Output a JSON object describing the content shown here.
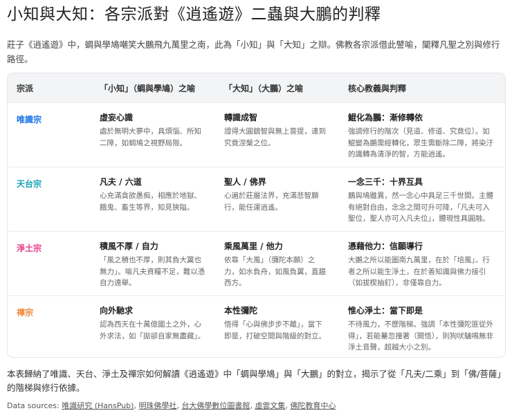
{
  "title": "小知與大知：各宗派對《逍遙遊》二蟲與大鵬的判釋",
  "intro": "莊子《逍遙遊》中，蜩與學鳩嘲笑大鵬飛九萬里之南，此為「小知」與「大知」之辯。佛教各宗派借此譬喻，闡釋凡聖之別與修行路徑。",
  "table": {
    "headers": [
      "宗派",
      "「小知」（蜩與學鳩）之喻",
      "「大知」（大鵬）之喻",
      "核心教義與判釋"
    ],
    "rows": [
      {
        "school": "唯識宗",
        "color": "#1a73e8",
        "small_title": "虛妄心識",
        "small_desc": "處於無明大夢中，具煩惱、所知二障，如蜩鳩之視野局限。",
        "big_title": "轉識成智",
        "big_desc": "證得大圓鏡智與無上菩提，達到究竟涅槃之位。",
        "core_title": "鯤化為鵬：漸修轉依",
        "core_desc": "強調修行的階次（見道、修道、究竟位）。如鯤變為鵬需經轉化，眾生需斷除二障，將染汙的識轉為清淨的智，方能逍遙。"
      },
      {
        "school": "天台宗",
        "color": "#17a2b8",
        "small_title": "凡夫 / 六道",
        "small_desc": "心充滿貪欲愚痴，相應於地獄、餓鬼、畜生等界，知見狹隘。",
        "big_title": "聖人 / 佛界",
        "big_desc": "心遍於莊嚴法界，充滿悲智願行，能任運逍遙。",
        "core_title": "一念三千：十界互具",
        "core_desc": "鵬與鳩雖異，然一念心中具足三千世間。主體有絕對自由，念念之間可升可降，「凡夫可入聖位，聖人亦可入凡夫位」，體現性具圓融。"
      },
      {
        "school": "淨土宗",
        "color": "#e83e8c",
        "small_title": "積風不厚 / 自力",
        "small_desc": "「風之積也不厚，則其負大翼也無力」。喻凡夫資糧不足，難以憑自力遠舉。",
        "big_title": "乘風萬里 / 他力",
        "big_desc": "依靠「大風」（彌陀本願）之力，如水負舟，如風負翼，直趨西方。",
        "core_title": "憑藉他力：信願導行",
        "core_desc": "大鵬之所以能圖南九萬里，在於「培風」。行者之所以能生淨土，在於善知識與佛力接引（如拔楔抽釘），非僅靠自力。"
      },
      {
        "school": "禪宗",
        "color": "#f0883e",
        "small_title": "向外馳求",
        "small_desc": "認為西天在十萬億國土之外，心外求法，如「拋卻自家無盡藏」。",
        "big_title": "本性彌陀",
        "big_desc": "悟得「心與佛步步不離」，當下即是，打破空間與階級的對立。",
        "core_title": "惟心淨土：當下即是",
        "core_desc": "不待風力，不歷階梯。強調「本性彌陀匪從外得」，若能驀忽撞著（開悟），則狗吠驢鳴無非淨土音聲，超越大小之別。"
      }
    ]
  },
  "footer": "本表歸納了唯識、天台、淨土及禪宗如何解讀《逍遙遊》中「蜩與學鳩」與「大鵬」的對立，揭示了從「凡夫/二乘」到「佛/菩薩」的階梯與修行依據。",
  "sources": {
    "label": "Data sources:",
    "links": [
      "唯識研究 (HansPub)",
      "明珠佛學社",
      "台大佛學數位圖書館",
      "虛雲文集",
      "佛陀教育中心"
    ]
  }
}
